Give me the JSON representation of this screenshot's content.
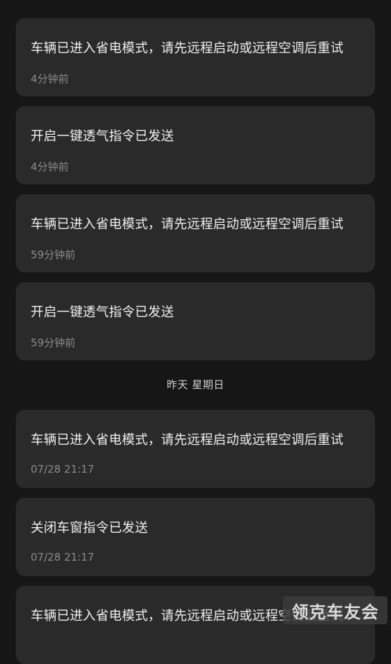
{
  "notifications": [
    {
      "message": "车辆已进入省电模式，请先远程启动或远程空调后重试",
      "time": "4分钟前"
    },
    {
      "message": "开启一键透气指令已发送",
      "time": "4分钟前"
    },
    {
      "message": "车辆已进入省电模式，请先远程启动或远程空调后重试",
      "time": "59分钟前"
    },
    {
      "message": "开启一键透气指令已发送",
      "time": "59分钟前"
    },
    {
      "message": "车辆已进入省电模式，请先远程启动或远程空调后重试",
      "time": "07/28 21:17"
    },
    {
      "message": "关闭车窗指令已发送",
      "time": "07/28 21:17"
    },
    {
      "message": "车辆已进入省电模式，请先远程启动或远程空调后重试",
      "time": ""
    }
  ],
  "date_separator": "昨天  星期日",
  "watermark": "领克车友会"
}
